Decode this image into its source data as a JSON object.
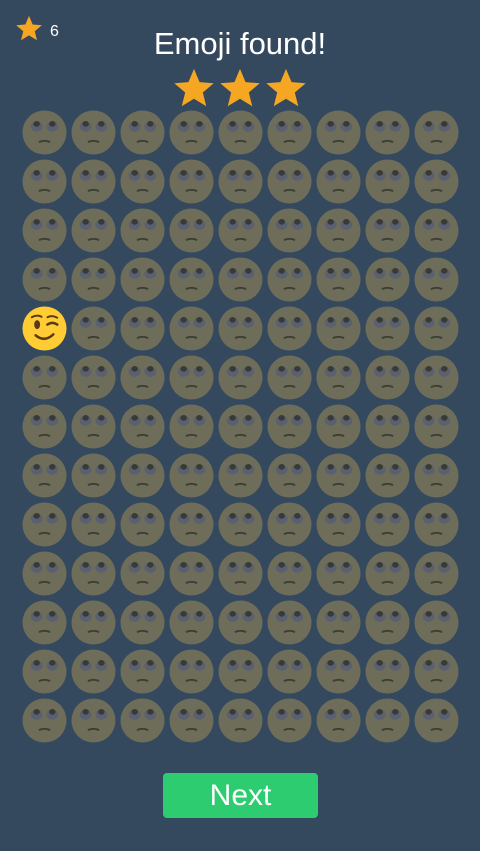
{
  "header": {
    "score_value": "6",
    "title": "Emoji found!",
    "earned_stars": 3
  },
  "grid": {
    "columns": 9,
    "rows": 13,
    "target": {
      "row": 5,
      "col": 1,
      "icon": "winking-face-icon"
    },
    "filler_icon": "face-with-rolling-eyes-icon"
  },
  "next_button": {
    "label": "Next"
  },
  "colors": {
    "background": "#34495e",
    "star": "#f5a623",
    "filler_face": "#6e6d5a",
    "target_face": "#ffcc33",
    "button": "#2ecc71"
  }
}
